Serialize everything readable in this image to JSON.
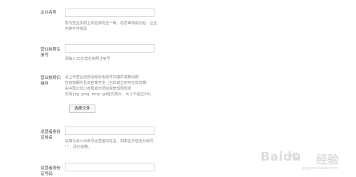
{
  "form": {
    "company_name": {
      "label": "企业名称",
      "value": "",
      "hint_lines": [
        "需与营业执照上的名称完全一致，信息审核成功后，企业",
        "名称不可修改"
      ]
    },
    "license_no": {
      "label_lines": [
        "营业执照注",
        "册号"
      ],
      "value": "",
      "hint": "请输入15位营业执照注册号"
    },
    "license_scan": {
      "label_lines": [
        "营业执照扫",
        "描件"
      ],
      "hint_lines": [
        "请上传营业执照清晰彩色原件扫描件或数码照",
        "在有效期内且年检章齐全（当年成立的可无年检章）",
        "由中国大陆工商局或市场监督管理局颁发",
        "支持.jpg .jpeg .bmp .gif格式照片，大小不超过2M。"
      ],
      "button_label": "选择文件"
    },
    "operator_name": {
      "label_lines": [
        "运营者身份",
        "证姓名"
      ],
      "value": "",
      "hint_lines": [
        "请填写该公众账号运营者的姓名，如果名字包含分隔号",
        "\"·\"，请勿省略。"
      ]
    },
    "operator_id": {
      "label_lines": [
        "运营者身份",
        "证号码"
      ],
      "value": ""
    }
  },
  "watermark": {
    "brand": "Baidu",
    "text": "经验",
    "url": "jingyan.baidu.com"
  }
}
